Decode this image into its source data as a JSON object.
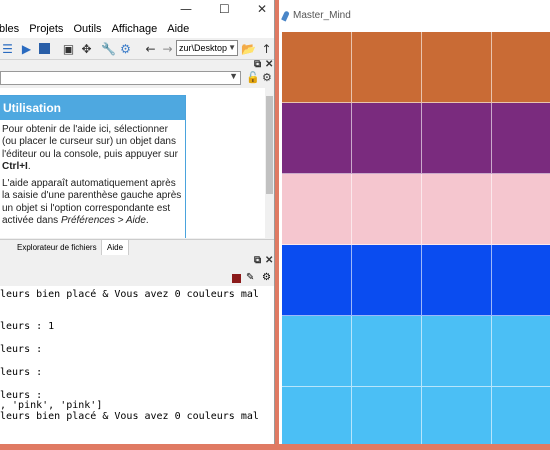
{
  "ide": {
    "window_controls": {
      "minimize": "—",
      "maximize": "☐",
      "close": "✕"
    },
    "menu": [
      "bles",
      "Projets",
      "Outils",
      "Affichage",
      "Aide"
    ],
    "path": "zur\\Desktop",
    "help": {
      "title": "Utilisation",
      "para1": "Pour obtenir de l'aide ici, sélectionner (ou placer le curseur sur) un objet dans l'éditeur ou la console, puis appuyer sur",
      "para1_key": "Ctrl+I",
      "para1_end": ".",
      "para2": "L'aide apparaît automatiquement après la saisie d'une parenthèse gauche après un objet si l'option correspondante est activée dans",
      "para2_ref": "Préférences > Aide",
      "para2_end": "."
    },
    "tabs": [
      "Explorateur de fichiers",
      "Aide"
    ],
    "console_lines": [
      "leurs bien placé & Vous avez 0 couleurs mal",
      "",
      "leurs : 1",
      "",
      "leurs :",
      "",
      "leurs :",
      "",
      "leurs :",
      ", 'pink', 'pink']",
      "leurs bien placé & Vous avez 0 couleurs mal"
    ]
  },
  "mastermind": {
    "title": "Master_Mind",
    "row_colors": [
      "#c96b35",
      "#7a2b7e",
      "#f5c6cf",
      "#0a4cf0",
      "#4bbff5",
      "#4bbff5"
    ],
    "columns": 4
  }
}
